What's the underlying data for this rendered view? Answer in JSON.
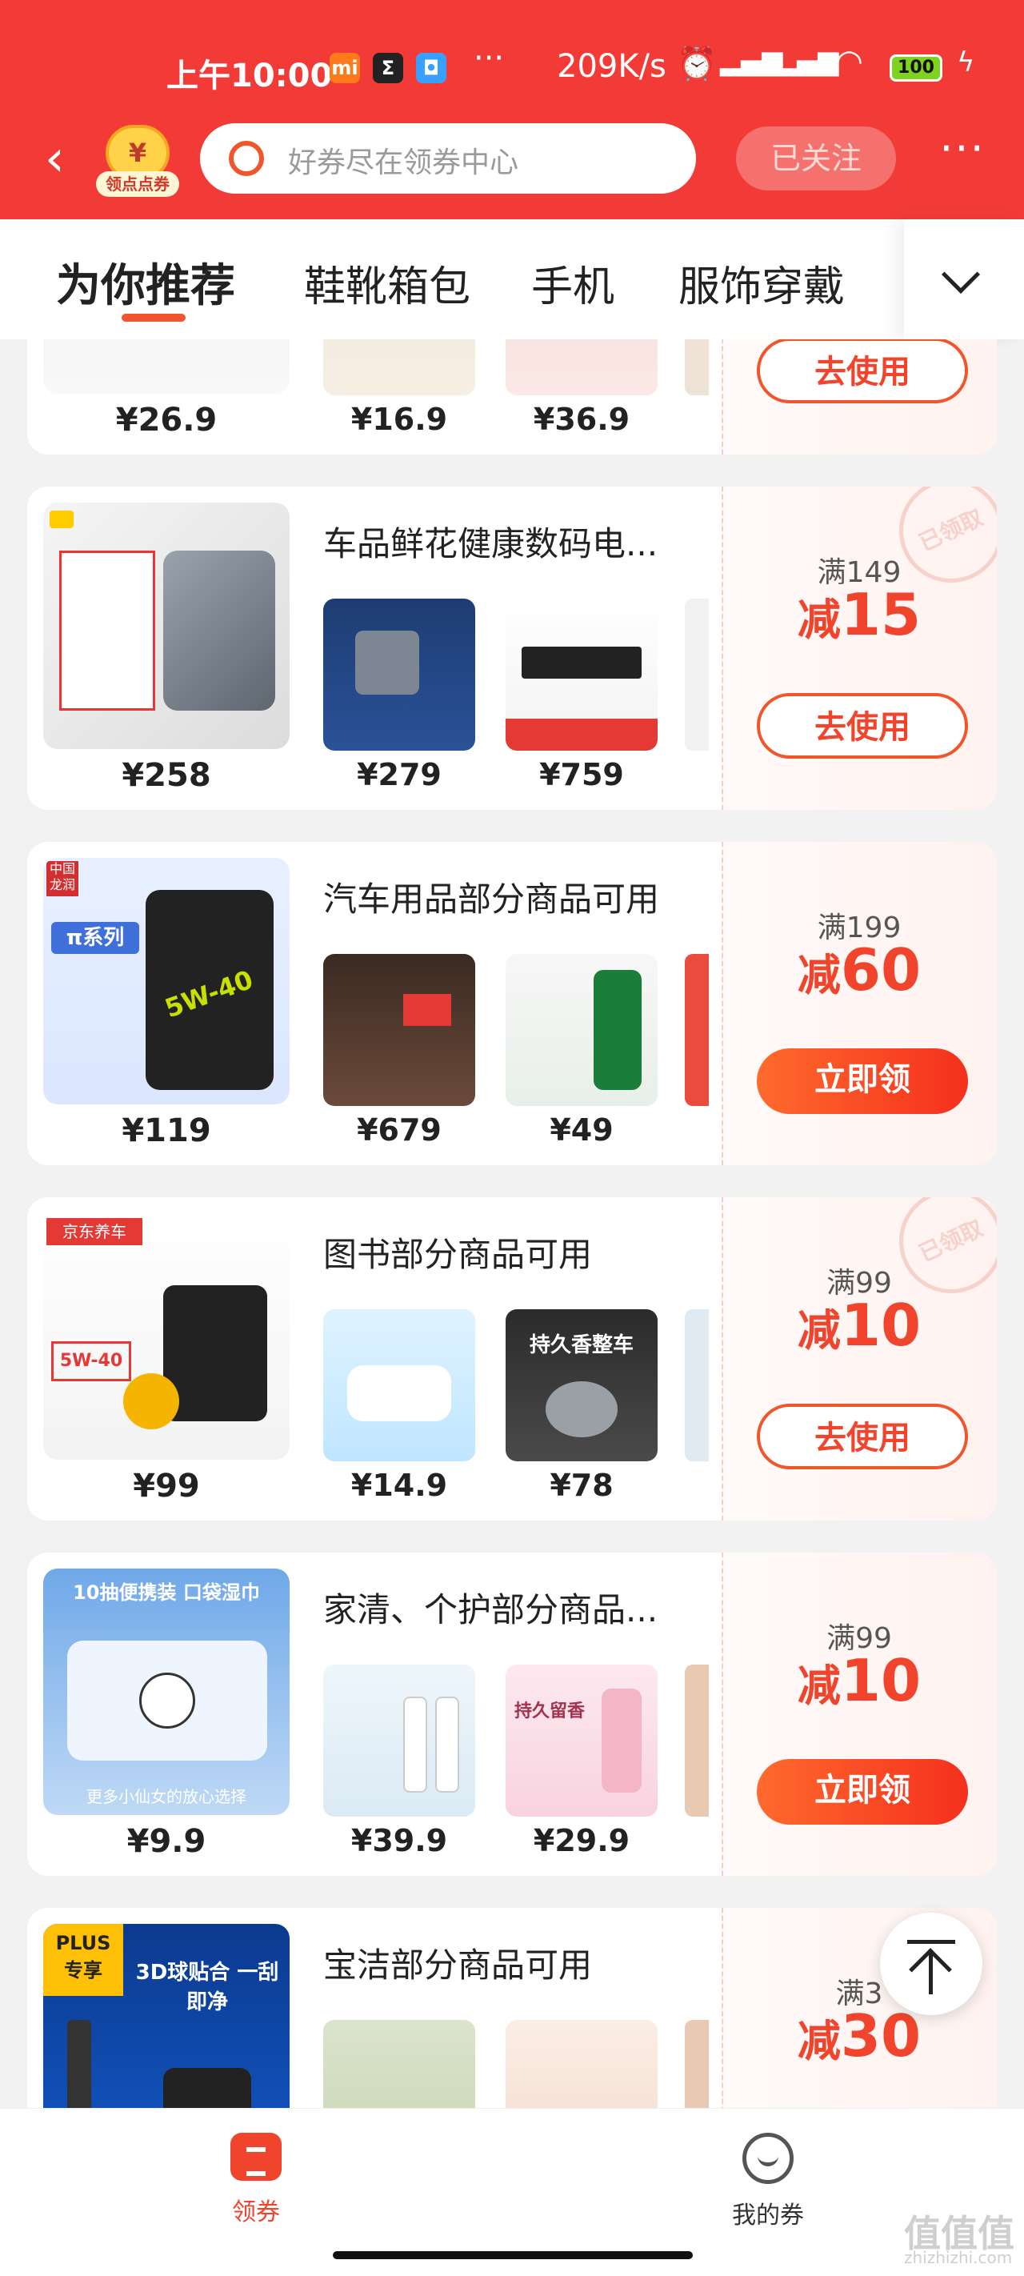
{
  "status_bar": {
    "time": "上午10:00",
    "net_speed": "209K/s",
    "battery": "100"
  },
  "header": {
    "points_badge_label": "领点点券",
    "search_placeholder": "好券尽在领券中心",
    "follow_label": "已关注",
    "more_label": "···"
  },
  "tabs": [
    "为你推荐",
    "鞋靴箱包",
    "手机",
    "服饰穿戴"
  ],
  "cards": [
    {
      "title": "",
      "main_price": "¥26.9",
      "thumb_prices": [
        "¥16.9",
        "¥36.9"
      ],
      "threshold": "",
      "discount_prefix": "",
      "discount_value": "",
      "cta": "去使用",
      "claimed": false
    },
    {
      "title": "车品鲜花健康数码电...",
      "main_price": "¥258",
      "thumb_prices": [
        "¥279",
        "¥759"
      ],
      "threshold": "满149",
      "discount_prefix": "减",
      "discount_value": "15",
      "cta": "去使用",
      "claimed": true,
      "stamp": "已领取"
    },
    {
      "title": "汽车用品部分商品可用",
      "main_price": "¥119",
      "thumb_prices": [
        "¥679",
        "¥49"
      ],
      "threshold": "满199",
      "discount_prefix": "减",
      "discount_value": "60",
      "cta": "立即领",
      "claimed": false,
      "image_text": [
        "中国龙润",
        "π系列",
        "5W-40"
      ]
    },
    {
      "title": "图书部分商品可用",
      "main_price": "¥99",
      "thumb_prices": [
        "¥14.9",
        "¥78"
      ],
      "threshold": "满99",
      "discount_prefix": "减",
      "discount_value": "10",
      "cta": "去使用",
      "claimed": true,
      "stamp": "已领取",
      "image_text": [
        "京东养车",
        "5W-40",
        "持久香整车"
      ]
    },
    {
      "title": "家清、个护部分商品...",
      "main_price": "¥9.9",
      "thumb_prices": [
        "¥39.9",
        "¥29.9"
      ],
      "threshold": "满99",
      "discount_prefix": "减",
      "discount_value": "10",
      "cta": "立即领",
      "claimed": false,
      "image_text": [
        "10抽便携装 口袋湿巾",
        "更多小仙女的放心选择",
        "持久留香"
      ]
    },
    {
      "title": "宝洁部分商品可用",
      "main_price": "",
      "thumb_prices": [
        "",
        ""
      ],
      "threshold": "满3",
      "discount_prefix": "减",
      "discount_value": "30",
      "cta": "",
      "claimed": false,
      "image_text": [
        "PLUS 专享",
        "3D球贴合 一刮即净"
      ]
    }
  ],
  "bottom_nav": {
    "coupon_label": "领券",
    "mine_label": "我的券"
  },
  "watermark": {
    "main": "值值值",
    "sub": "zhizhizhi.com"
  },
  "colors": {
    "header_red": "#f23b36",
    "accent_orange": "#f0452c"
  }
}
